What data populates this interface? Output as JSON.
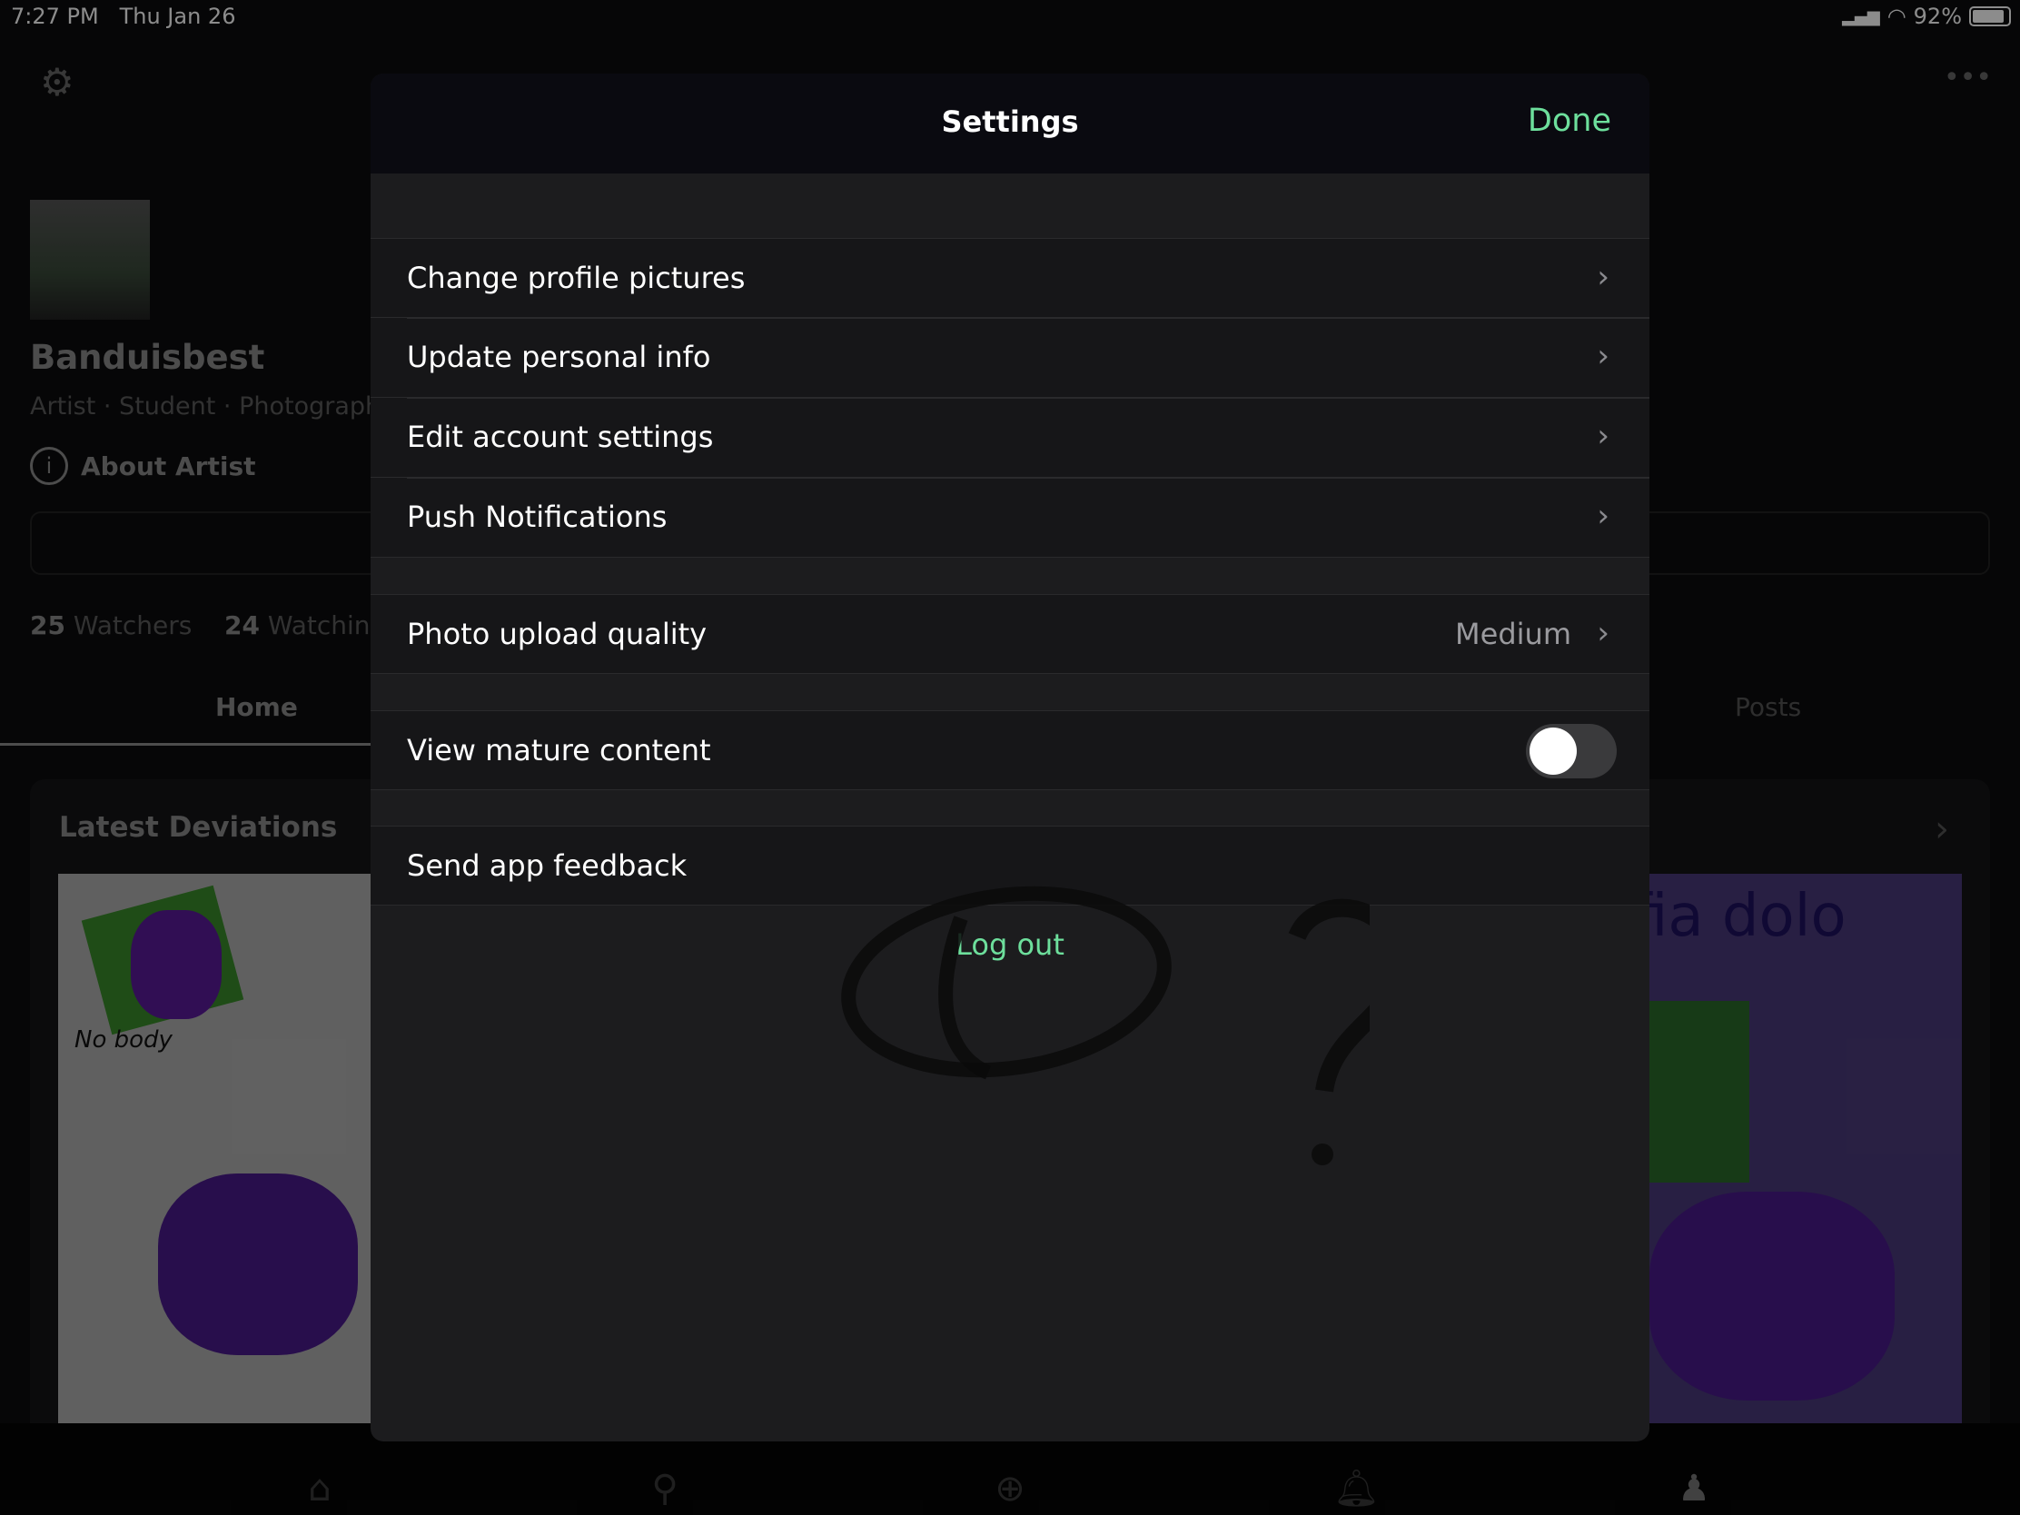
{
  "status_bar": {
    "time": "7:27 PM",
    "date": "Thu Jan 26",
    "battery": "92%"
  },
  "profile": {
    "username": "Banduisbest",
    "tagline": "Artist · Student · Photograph",
    "about_label": "About Artist",
    "watchers_count": "25",
    "watchers_label": "Watchers",
    "watching_count": "24",
    "watching_label": "Watching"
  },
  "tabs": {
    "home": "Home",
    "posts": "Posts"
  },
  "latest": {
    "title": "Latest Deviations",
    "art1_text": "No body",
    "art2_text": "fia dolo"
  },
  "modal": {
    "title": "Settings",
    "done": "Done",
    "group1": [
      {
        "label": "Change profile pictures"
      },
      {
        "label": "Update personal info"
      },
      {
        "label": "Edit account settings"
      },
      {
        "label": "Push Notifications"
      }
    ],
    "photo_quality": {
      "label": "Photo upload quality",
      "value": "Medium"
    },
    "mature": {
      "label": "View mature content",
      "enabled": false
    },
    "feedback": {
      "label": "Send app feedback"
    },
    "logout": "Log out"
  },
  "colors": {
    "accent": "#6ddf9c",
    "background": "#1c1c1e"
  },
  "bottom_nav": [
    "home-icon",
    "search-icon",
    "create-icon",
    "notifications-icon",
    "profile-icon"
  ]
}
